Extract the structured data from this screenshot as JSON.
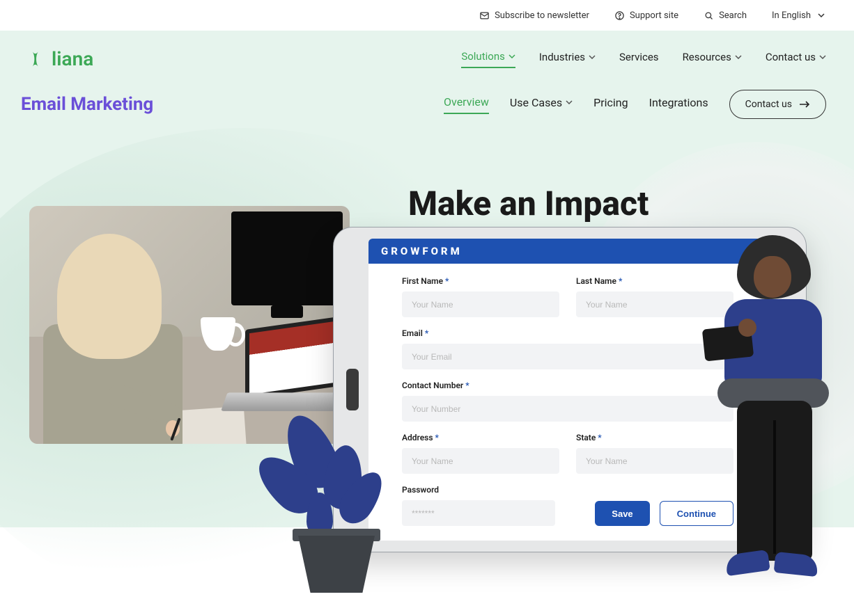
{
  "topbar": {
    "newsletter": "Subscribe to newsletter",
    "support": "Support site",
    "search": "Search",
    "language": "In English"
  },
  "brand": {
    "name": "liana"
  },
  "nav": {
    "solutions": "Solutions",
    "industries": "Industries",
    "services": "Services",
    "resources": "Resources",
    "contact": "Contact us"
  },
  "page": {
    "title": "Email Marketing",
    "headline": "Make an Impact"
  },
  "subnav": {
    "overview": "Overview",
    "usecases": "Use Cases",
    "pricing": "Pricing",
    "integrations": "Integrations",
    "contact": "Contact us"
  },
  "form": {
    "brand": "GROWFORM",
    "first_name_label": "First Name",
    "first_name_ph": "Your Name",
    "last_name_label": "Last Name",
    "last_name_ph": "Your Name",
    "email_label": "Email",
    "email_ph": "Your Email",
    "contact_label": "Contact  Number",
    "contact_ph": "Your Number",
    "address_label": "Address",
    "address_ph": "Your Name",
    "state_label": "State",
    "state_ph": "Your Name",
    "password_label": "Password",
    "password_ph": "*******",
    "save": "Save",
    "continue": "Continue",
    "asterisk": "*"
  }
}
